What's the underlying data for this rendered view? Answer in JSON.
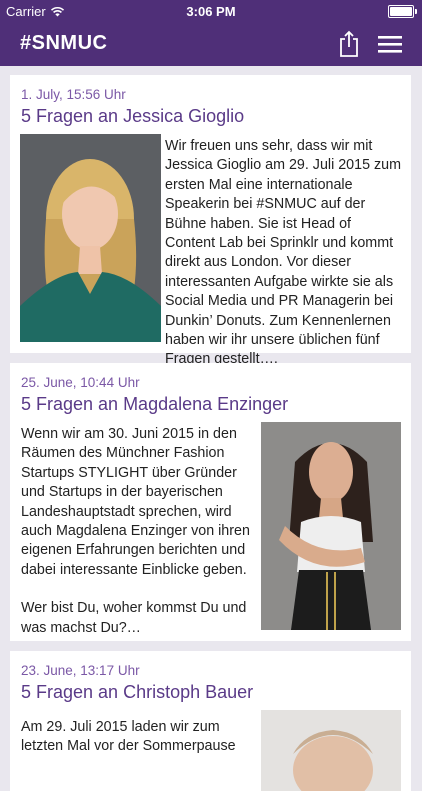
{
  "status": {
    "carrier": "Carrier",
    "time": "3:06 PM"
  },
  "nav": {
    "title": "#SNMUC",
    "share_icon": "share-icon",
    "menu_icon": "menu-icon"
  },
  "posts": [
    {
      "date": "1. July, 15:56 Uhr",
      "title": "5 Fragen an Jessica Gioglio",
      "body": "Wir freuen uns sehr, dass wir mit Jessica Gioglio am 29. Juli 2015 zum ersten Mal eine internationale Speakerin bei #SNMUC auf der Bühne haben. Sie ist Head of Content Lab bei Sprinklr und kommt direkt aus London. Vor dieser interessanten Aufgabe wirkte sie als Social Media und PR Managerin bei Dunkin’ Donuts. Zum Kennenlernen haben wir ihr unsere üblichen fünf Fragen gestellt…."
    },
    {
      "date": "25. June, 10:44 Uhr",
      "title": "5 Fragen an Magdalena Enzinger",
      "body": "Wenn wir am 30. Juni 2015 in den Räumen des Münchner Fashion Startups STYLIGHT über Gründer und Startups in der bayerischen Landeshauptstadt sprechen, wird auch Magdalena Enzinger von ihren eigenen Erfahrungen berichten und dabei interessante Einblicke geben.",
      "body2": "Wer bist Du, woher kommst Du und was machst Du?…"
    },
    {
      "date": "23. June, 13:17 Uhr",
      "title": "5 Fragen an Christoph Bauer",
      "body": "Am 29. Juli 2015 laden wir zum letzten Mal vor der Sommerpause"
    }
  ],
  "colors": {
    "brand": "#4f2f78",
    "accent": "#7b58a6",
    "background": "#e9e7ee"
  }
}
